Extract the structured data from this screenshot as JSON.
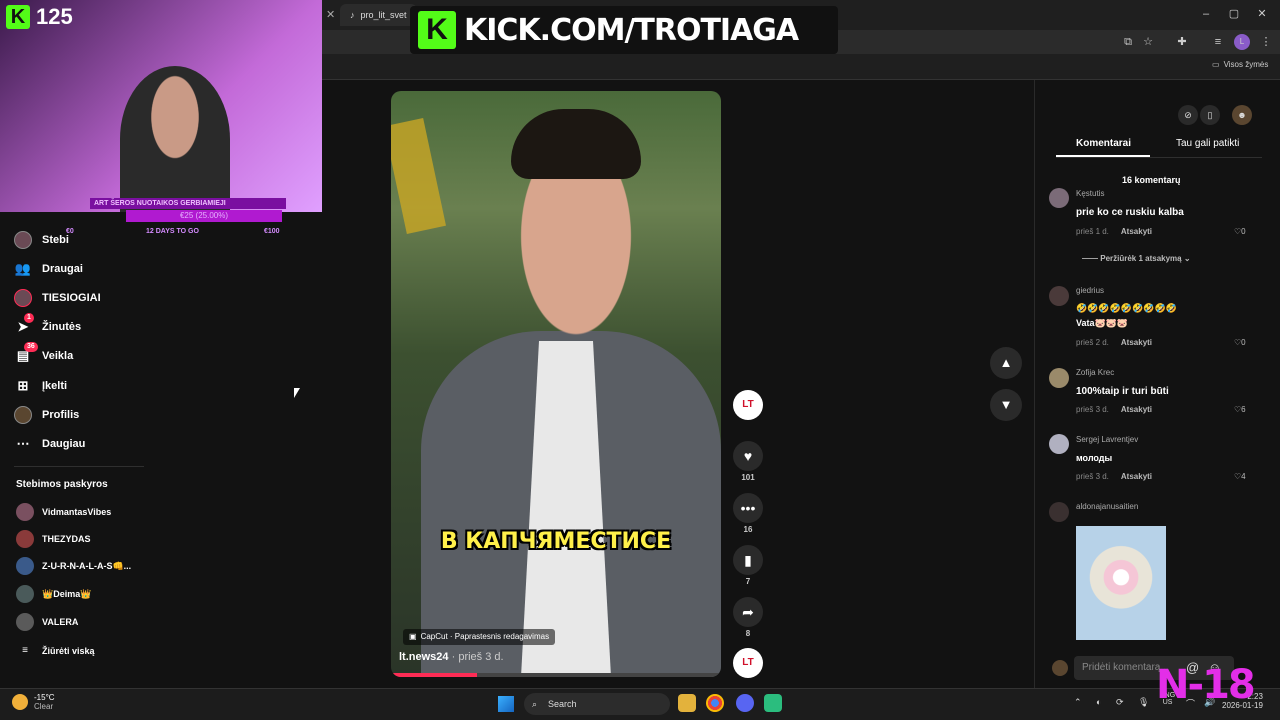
{
  "browser": {
    "tab_label": "pro_lit_svet",
    "bookmarks_label": "Visos žymės"
  },
  "overlay": {
    "banner_text": "KICK.COM/TROTIAGA",
    "kick_badge": "K",
    "viewer_count": "125",
    "goal_title": "ART ŠEROS NUOTAIKOS GERBIAMIEJI",
    "goal_amount": "€25 (25.00%)",
    "goal_start": "€0",
    "goal_days": "12 DAYS TO GO",
    "goal_end": "€100",
    "rating": "N-18"
  },
  "sidebar": {
    "items": [
      {
        "label": "Stebi",
        "icon": "avatar"
      },
      {
        "label": "Draugai",
        "icon": "friends-icon"
      },
      {
        "label": "TIESIOGIAI",
        "icon": "avatar"
      },
      {
        "label": "Žinutės",
        "icon": "send-icon",
        "badge": "1"
      },
      {
        "label": "Veikla",
        "icon": "activity-icon",
        "badge": "36"
      },
      {
        "label": "Įkelti",
        "icon": "upload-icon"
      },
      {
        "label": "Profilis",
        "icon": "avatar"
      },
      {
        "label": "Daugiau",
        "icon": "more-icon"
      }
    ],
    "following_title": "Stebimos paskyros",
    "accounts": [
      {
        "name": "VidmantasVibes"
      },
      {
        "name": "THEZYDAS"
      },
      {
        "name": "Z-U-R-N-A-L-A-S👊..."
      },
      {
        "name": "👑Deima👑"
      },
      {
        "name": "VALERA"
      }
    ],
    "see_all": "Žiūrėti viską"
  },
  "video": {
    "caption": "В КАПЧЯМЕСТИСЕ",
    "capcut_label": "CapCut · Paprastesnis redagavimas",
    "author": "lt.news24",
    "time": "prieš 3 d.",
    "progress": 0.26
  },
  "actions": {
    "avatar_text": "LT",
    "likes": "101",
    "comments": "16",
    "saves": "7",
    "shares": "8"
  },
  "comments_panel": {
    "tab_comments": "Komentarai",
    "tab_suggest": "Tau gali patikti",
    "count_label": "16 komentarų",
    "reply_label": "Atsakyti",
    "view_replies": "Peržiūrėk 1 atsakymą",
    "items": [
      {
        "name": "Kęstutis",
        "text": "prie ko ce ruskiu kalba",
        "time": "prieš 1 d.",
        "likes": "0"
      },
      {
        "name": "giedrius",
        "text": "🤣🤣🤣🤣🤣🤣🤣🤣🤣",
        "text2": "Vata🐷🐷🐷",
        "time": "prieš 2 d.",
        "likes": "0"
      },
      {
        "name": "Zofija Krec",
        "text": "100%taip ir turi būti",
        "time": "prieš 3 d.",
        "likes": "6"
      },
      {
        "name": "Sergej Lavrentjev",
        "text": "молоды",
        "time": "prieš 3 d.",
        "likes": "4"
      },
      {
        "name": "aldonajanusaitien"
      }
    ],
    "input_placeholder": "Pridėti komentarą..."
  },
  "taskbar": {
    "temp": "-15°C",
    "weather": "Clear",
    "search": "Search",
    "lang1": "ENG",
    "lang2": "US",
    "time": "2:23",
    "date": "2026-01-19"
  },
  "colors": {
    "kick_green": "#53fc18",
    "tiktok_red": "#fe2c55",
    "rating_magenta": "#e32ee8"
  }
}
